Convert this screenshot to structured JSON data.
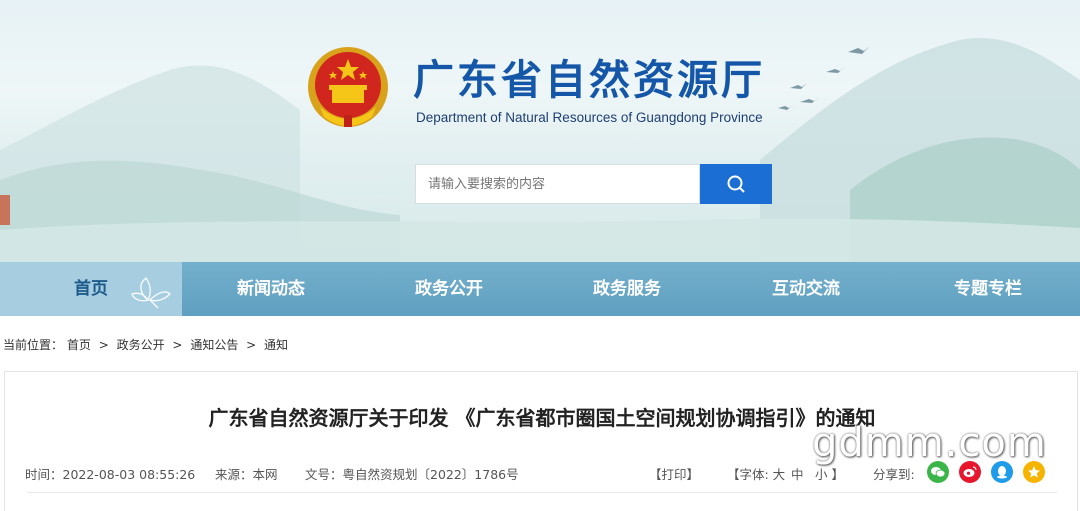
{
  "header": {
    "title": "广东省自然资源厅",
    "subtitle": "Department of Natural Resources of Guangdong Province",
    "emblem_icon": "national-emblem-icon"
  },
  "search": {
    "placeholder": "请输入要搜索的内容",
    "button_icon": "search-icon"
  },
  "nav": {
    "items": [
      {
        "label": "首页",
        "active": true
      },
      {
        "label": "新闻动态"
      },
      {
        "label": "政务公开"
      },
      {
        "label": "政务服务"
      },
      {
        "label": "互动交流"
      },
      {
        "label": "专题专栏"
      }
    ]
  },
  "breadcrumb": {
    "prefix": "当前位置：",
    "items": [
      "首页",
      "政务公开",
      "通知公告",
      "通知"
    ],
    "separator": ">"
  },
  "article": {
    "title": "广东省自然资源厅关于印发 《广东省都市圈国土空间规划协调指引》的通知",
    "time": "时间：2022-08-03 08:55:26",
    "source": "来源：本网",
    "doc_number": "文号：粤自然资规划〔2022〕1786号",
    "print": "【打印】",
    "font_size_label": "【字体: 大",
    "font_medium": "中",
    "font_small": "小 】",
    "share_label": "分享到:",
    "share_icons": [
      "wechat-icon",
      "weibo-icon",
      "qq-icon",
      "qzone-icon"
    ]
  },
  "watermark": "gdmm.com",
  "colors": {
    "title_blue": "#1456a8",
    "search_button": "#1b6fd4",
    "nav_bg": "#6aa8c6",
    "nav_active_bg": "#a6cde0",
    "wechat": "#3bb54a",
    "weibo": "#e6162d",
    "qq": "#1e9be9",
    "qzone": "#f5b400"
  }
}
